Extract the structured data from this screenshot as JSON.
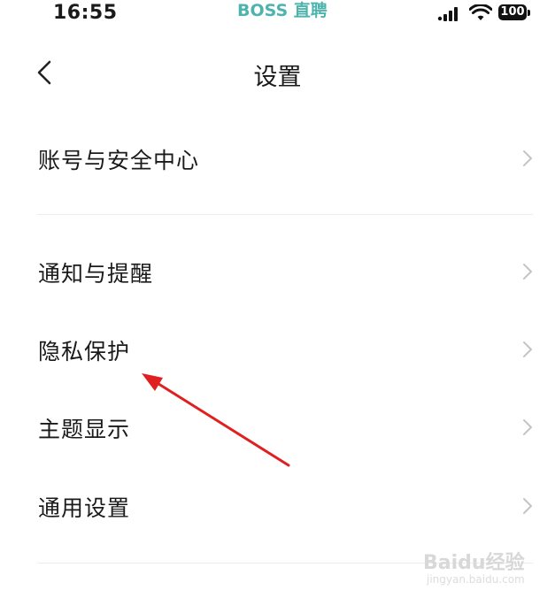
{
  "status_bar": {
    "time": "16:55",
    "app_name": "BOSS 直聘",
    "battery": "100",
    "icons": [
      "signal-icon",
      "wifi-icon",
      "battery-icon"
    ]
  },
  "nav": {
    "title": "设置",
    "back_icon": "chevron-left-icon"
  },
  "settings": {
    "items": [
      {
        "label": "账号与安全中心"
      },
      {
        "label": "通知与提醒"
      },
      {
        "label": "隐私保护"
      },
      {
        "label": "主题显示"
      },
      {
        "label": "通用设置"
      }
    ]
  },
  "annotation": {
    "color": "#e02020",
    "points_to": "隐私保护"
  },
  "watermark": {
    "text": "Baidu经验",
    "sub": "jingyan.baidu.com"
  },
  "colors": {
    "app_name": "#4fb3ad",
    "divider": "#ececec",
    "chevron": "#c4c4c4"
  }
}
